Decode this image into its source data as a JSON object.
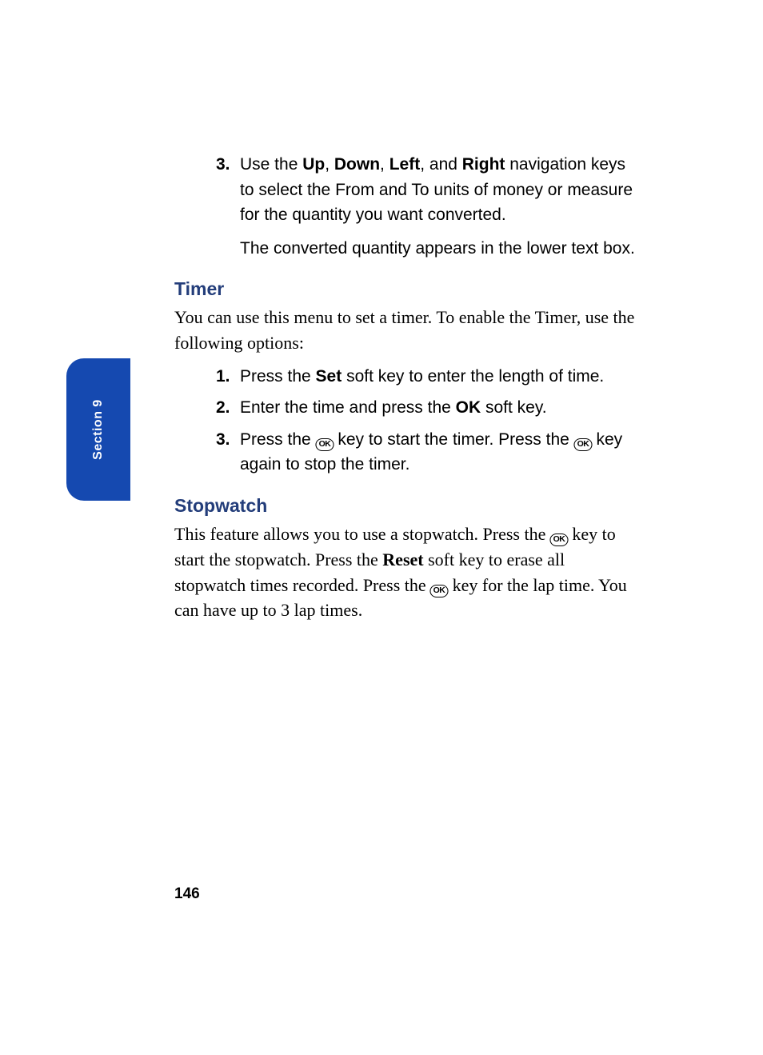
{
  "section_tab": "Section  9",
  "top_step": {
    "num": "3.",
    "text_before_up": "Use the ",
    "up": "Up",
    "sep1": ", ",
    "down": "Down",
    "sep2": ", ",
    "left": "Left",
    "sep3": ", and ",
    "right": "Right",
    "text_after": " navigation keys to select the From and To units of money or measure for the quantity you want converted.",
    "cont": "The converted quantity appears in the lower text box."
  },
  "timer": {
    "heading": "Timer",
    "intro": "You can use this menu to set a timer. To enable the Timer, use the following options:",
    "steps": [
      {
        "num": "1.",
        "before_set": "Press the ",
        "set": "Set",
        "after_set": " soft key to enter the length of time."
      },
      {
        "num": "2.",
        "before_ok": "Enter the time and press the ",
        "ok": "OK",
        "after_ok": " soft key."
      },
      {
        "num": "3.",
        "a": "Press the ",
        "ok_icon1": "OK",
        "b": " key to start the timer. Press the ",
        "ok_icon2": "OK",
        "c": " key again to stop the timer."
      }
    ]
  },
  "stopwatch": {
    "heading": "Stopwatch",
    "a": "This feature allows you to use a stopwatch. Press the ",
    "ok1": "OK",
    "b": " key to start the stopwatch. Press the ",
    "reset": "Reset",
    "c": " soft key to erase all stopwatch times recorded. Press the ",
    "ok2": "OK",
    "d": " key for the lap time. You can have up to 3 lap times."
  },
  "page_number": "146"
}
